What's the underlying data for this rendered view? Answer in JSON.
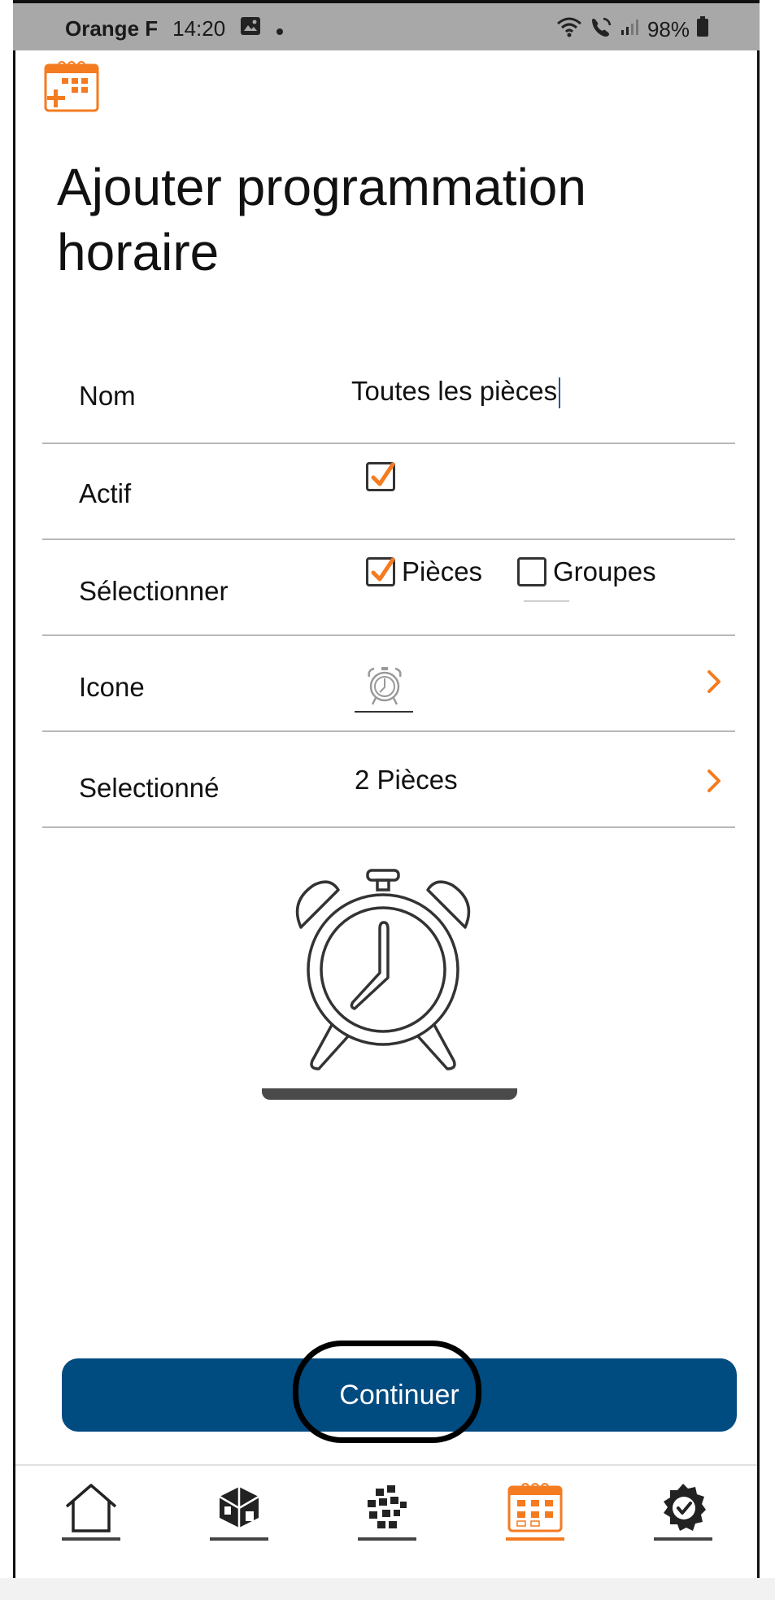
{
  "status_bar": {
    "carrier": "Orange F",
    "time": "14:20",
    "battery": "98%",
    "icons": [
      "image-icon",
      "dot-icon",
      "wifi-icon",
      "call-icon",
      "signal-icon",
      "battery-icon"
    ]
  },
  "header": {
    "app_icon": "calendar-add-icon",
    "title": "Ajouter programmation horaire"
  },
  "form": {
    "name_label": "Nom",
    "name_value": "Toutes les pièces",
    "active_label": "Actif",
    "active_checked": true,
    "select_label": "Sélectionner",
    "option_rooms_label": "Pièces",
    "option_rooms_checked": true,
    "option_groups_label": "Groupes",
    "option_groups_checked": false,
    "icon_label": "Icone",
    "icon_value": "alarm-clock-icon",
    "selected_label": "Selectionné",
    "selected_value": "2 Pièces"
  },
  "preview": {
    "icon": "alarm-clock-icon"
  },
  "actions": {
    "continue_label": "Continuer"
  },
  "bottom_nav": {
    "active": "schedule",
    "items": [
      "home-icon",
      "room-icon",
      "group-icon",
      "schedule-icon",
      "settings-icon"
    ]
  },
  "colors": {
    "accent": "#f47b20",
    "primary": "#004b80"
  }
}
